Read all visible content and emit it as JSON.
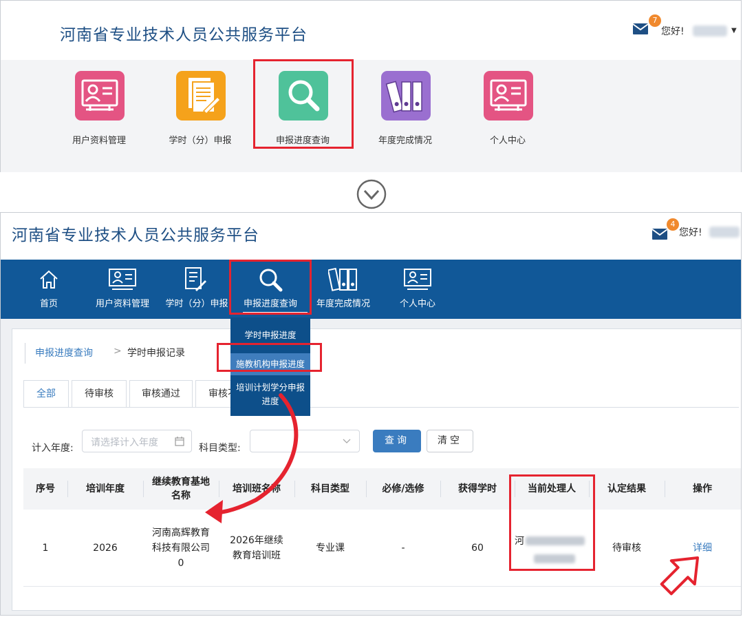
{
  "site_title": "河南省专业技术人员公共服务平台",
  "top_panel": {
    "mail_count": "7",
    "greeting": "您好!",
    "tiles": [
      {
        "label": "用户资料管理",
        "color": "#e45483",
        "icon": "user-card-icon"
      },
      {
        "label": "学时（分）申报",
        "color": "#f5a21b",
        "icon": "document-pen-icon"
      },
      {
        "label": "申报进度查询",
        "color": "#4fc29a",
        "icon": "search-icon"
      },
      {
        "label": "年度完成情况",
        "color": "#9a6fd0",
        "icon": "binders-icon"
      },
      {
        "label": "个人中心",
        "color": "#e45483",
        "icon": "user-card-icon"
      }
    ]
  },
  "bottom_panel": {
    "mail_count": "4",
    "greeting": "您好!",
    "nav": [
      {
        "label": "首页",
        "icon": "home-icon"
      },
      {
        "label": "用户资料管理",
        "icon": "user-card-icon"
      },
      {
        "label": "学时（分）申报",
        "icon": "document-pen-icon"
      },
      {
        "label": "申报进度查询",
        "icon": "search-icon"
      },
      {
        "label": "年度完成情况",
        "icon": "binders-icon"
      },
      {
        "label": "个人中心",
        "icon": "user-card-icon"
      }
    ],
    "dropdown": {
      "item1": "学时申报进度",
      "item2": "施教机构申报进度",
      "item3_line1": "培训计划学分申报",
      "item3_line2": "进度"
    },
    "breadcrumb": {
      "link": "申报进度查询",
      "separator": ">",
      "current": "学时申报记录"
    },
    "tabs": [
      "全部",
      "待审核",
      "审核通过",
      "审核不"
    ],
    "filters": {
      "year_label": "计入年度:",
      "year_placeholder": "请选择计入年度",
      "type_label": "科目类型:",
      "query_button": "查询",
      "clear_button": "清空"
    },
    "table": {
      "headers": {
        "seq": "序号",
        "year": "培训年度",
        "base_line1": "继续教育基地",
        "base_line2": "名称",
        "class": "培训班名称",
        "subject": "科目类型",
        "required": "必修/选修",
        "hours": "获得学时",
        "handler": "当前处理人",
        "result": "认定结果",
        "action": "操作"
      },
      "row": {
        "seq": "1",
        "year": "2026",
        "base_line1": "河南高辉教育",
        "base_line2": "科技有限公司",
        "base_line3": "0",
        "class_line1": "2026年继续",
        "class_line2": "教育培训班",
        "subject": "专业课",
        "required": "-",
        "hours": "60",
        "handler_first_char": "河",
        "result": "待审核",
        "action": "详细"
      }
    }
  },
  "colors": {
    "nav_bg": "#115898",
    "accent": "#3a7cbf",
    "highlight": "#e5232f",
    "badge": "#f0892d"
  }
}
